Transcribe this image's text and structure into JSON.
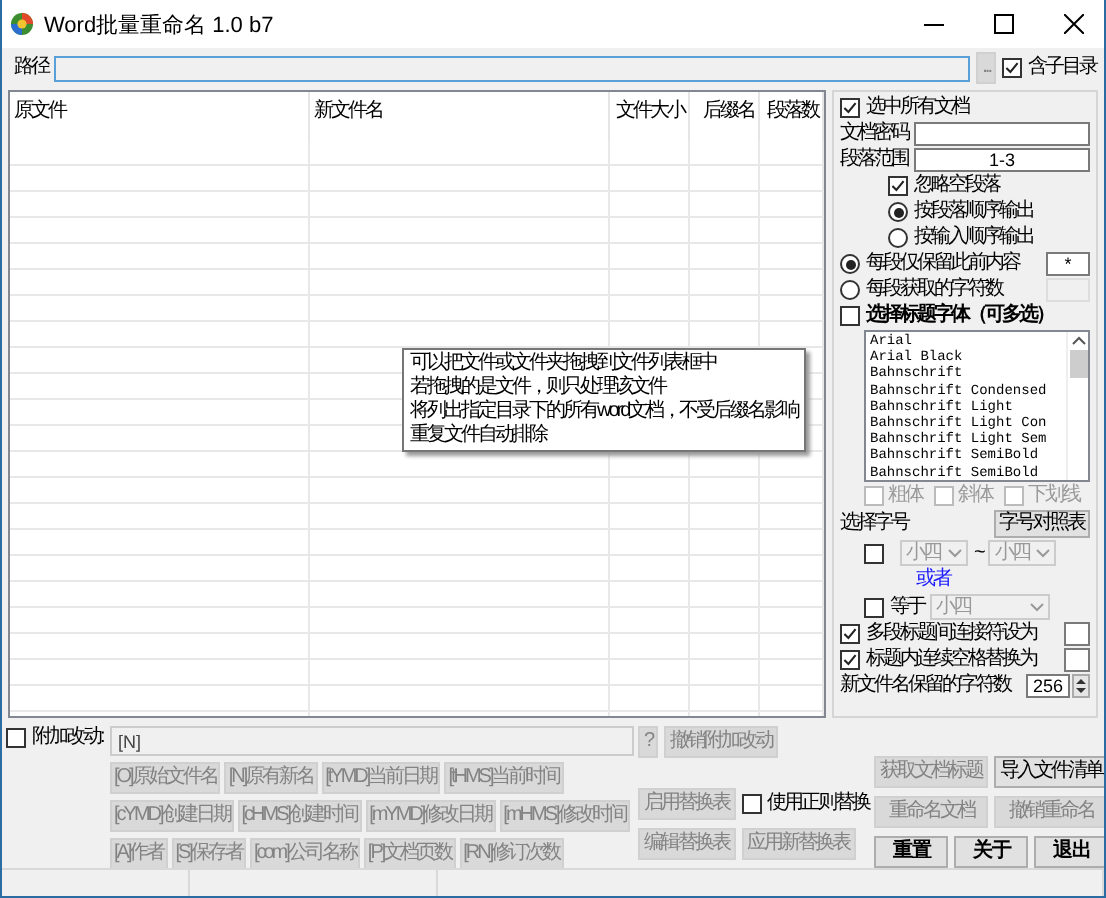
{
  "window": {
    "title": "Word批量重命名 1.0 b7"
  },
  "path": {
    "label": "路径",
    "browse": "...",
    "subdirs": {
      "label": "含子目录",
      "checked": true
    }
  },
  "table": {
    "columns": [
      "原文件",
      "新文件名",
      "文件大小",
      "后缀名",
      "段落数"
    ]
  },
  "tooltip": [
    "可以把文件或文件夹拖拽到文件列表框中",
    "若拖拽的是文件，则只处理该文件",
    "将列出指定目录下的所有word文档，不受后缀名影响",
    "重复文件自动排除"
  ],
  "options": {
    "select_all": {
      "label": "选中所有文档",
      "checked": true
    },
    "password": {
      "label": "文档密码"
    },
    "range": {
      "label": "段落范围",
      "value": "1-3"
    },
    "ignore_empty": {
      "label": "忽略空段落",
      "checked": true
    },
    "order": [
      {
        "label": "按段落顺序输出",
        "selected": true
      },
      {
        "label": "按输入顺序输出",
        "selected": false
      }
    ],
    "modes": [
      {
        "label": "每段仅保留此前内容",
        "selected": true,
        "value": "*"
      },
      {
        "label": "每段获取的字符数",
        "selected": false
      }
    ],
    "title_font": {
      "label": "选择标题字体（可多选）",
      "checked": false
    },
    "fonts": [
      "Arial",
      "Arial Black",
      "Bahnschrift",
      "Bahnschrift Condensed",
      "Bahnschrift Light",
      "Bahnschrift Light Con",
      "Bahnschrift Light Sem",
      "Bahnschrift SemiBold",
      "Bahnschrift SemiBold"
    ],
    "styles": [
      {
        "label": "粗体",
        "checked": false,
        "disabled": true
      },
      {
        "label": "斜体",
        "checked": false,
        "disabled": true
      },
      {
        "label": "下划线",
        "checked": false,
        "disabled": true
      }
    ],
    "font_size": {
      "label": "选择字号",
      "button": "字号对照表"
    },
    "size_range": {
      "checked": false,
      "from": "小四",
      "sep": "~",
      "to": "小四"
    },
    "or_text": "或者",
    "equal": {
      "label": "等于",
      "checked": false,
      "value": "小四"
    },
    "join": {
      "label": "多段标题间连接符设为",
      "checked": true
    },
    "space": {
      "label": "标题内连续空格替换为",
      "checked": true
    },
    "keep": {
      "label": "新文件名保留的字符数",
      "value": "256"
    }
  },
  "append": {
    "label": "附加改动:",
    "checked": false,
    "value": "[N]",
    "help": "?",
    "undo": "撤销附加改动"
  },
  "tokens": [
    "[O]原始文件名",
    "[N]原有新名",
    "[tYMD]当前日期",
    "[tHMS]当前时间",
    "[cYMD]创建日期",
    "[cHMS]创建时间",
    "[mYMD]修改日期",
    "[mHMS]修改时间",
    "[A]作者",
    "[S]保存者",
    "[com]公司名称",
    "[P]文档页数",
    "[RN]修订次数"
  ],
  "replace": {
    "enable": "启用替换表",
    "regex": {
      "label": "使用正则替换",
      "checked": false
    },
    "edit": "编辑替换表",
    "apply": "应用新替换表"
  },
  "actions": [
    {
      "label": "获取文档标题",
      "disabled": true
    },
    {
      "label": "导入文件清单",
      "disabled": false
    },
    {
      "label": "重命名文档",
      "disabled": true
    },
    {
      "label": "撤销重命名",
      "disabled": true
    },
    {
      "label": "重 置",
      "disabled": false
    },
    {
      "label": "关 于",
      "disabled": false
    },
    {
      "label": "退 出",
      "disabled": false
    }
  ]
}
